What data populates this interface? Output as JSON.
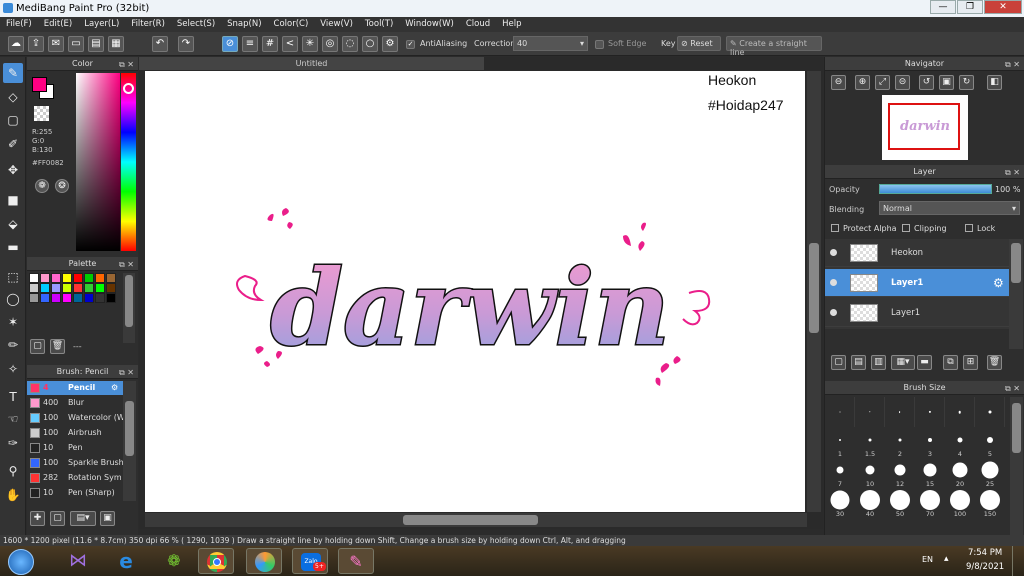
{
  "window": {
    "title": "MediBang Paint Pro (32bit)",
    "min": "—",
    "max": "❐",
    "close": "✕"
  },
  "menu": [
    "File(F)",
    "Edit(E)",
    "Layer(L)",
    "Filter(R)",
    "Select(S)",
    "Snap(N)",
    "Color(C)",
    "View(V)",
    "Tool(T)",
    "Window(W)",
    "Cloud",
    "Help"
  ],
  "toolbar": {
    "antialiasing_label": "AntiAliasing",
    "correction_label": "Correction",
    "correction_value": "40",
    "soft_edge_label": "Soft Edge",
    "key_label": "Key",
    "reset_label": "Reset",
    "straight_line_label": "Create a straight line"
  },
  "color_panel": {
    "title": "Color",
    "r": "R:255",
    "g": "G:0",
    "b": "B:130",
    "hex": "#FF0082",
    "primary_color": "#FF0082"
  },
  "palette_panel": {
    "title": "Palette",
    "swatches": [
      "#ffffff",
      "#ff99cc",
      "#ff66cc",
      "#ffff00",
      "#ff0000",
      "#00cc00",
      "#ff6600",
      "#996633",
      "#cccccc",
      "#00ccff",
      "#9999ff",
      "#ccff00",
      "#ff3333",
      "#33cc33",
      "#00ff00",
      "#663300",
      "#999999",
      "#3366ff",
      "#cc00ff",
      "#ff00ff",
      "#006699",
      "#0000cc",
      "#333333",
      "#000000"
    ],
    "footer": "---"
  },
  "brush_panel": {
    "title": "Brush: Pencil",
    "items": [
      {
        "size": "4",
        "name": "Pencil",
        "color": "#ff3366",
        "selected": true
      },
      {
        "size": "400",
        "name": "Blur",
        "color": "#ff99cc",
        "selected": false
      },
      {
        "size": "100",
        "name": "Watercolor (W",
        "color": "#66ccff",
        "selected": false
      },
      {
        "size": "100",
        "name": "Airbrush",
        "color": "#cccccc",
        "selected": false
      },
      {
        "size": "10",
        "name": "Pen",
        "color": "#222222",
        "selected": false
      },
      {
        "size": "100",
        "name": "Sparkle Brush",
        "color": "#3366ff",
        "selected": false
      },
      {
        "size": "282",
        "name": "Rotation Sym",
        "color": "#ff3333",
        "selected": false
      },
      {
        "size": "10",
        "name": "Pen (Sharp)",
        "color": "#222222",
        "selected": false
      }
    ]
  },
  "canvas": {
    "tab_title": "Untitled",
    "watermark_line1": "Heokon",
    "watermark_line2": "#Hoidap247",
    "artwork_text": "darwin"
  },
  "navigator": {
    "title": "Navigator",
    "thumb_text": "darwin"
  },
  "layer_panel": {
    "title": "Layer",
    "opacity_label": "Opacity",
    "opacity_value": "100 %",
    "blending_label": "Blending",
    "blending_value": "Normal",
    "protect_alpha": "Protect Alpha",
    "clipping": "Clipping",
    "lock": "Lock",
    "layers": [
      {
        "name": "Heokon",
        "selected": false
      },
      {
        "name": "Layer1",
        "selected": true
      },
      {
        "name": "Layer1",
        "selected": false
      }
    ]
  },
  "brush_size_panel": {
    "title": "Brush Size",
    "sizes": [
      "1",
      "1.5",
      "2",
      "3",
      "4",
      "5",
      "7",
      "10",
      "12",
      "15",
      "20",
      "25",
      "30",
      "40",
      "50",
      "70",
      "100",
      "150"
    ]
  },
  "status": {
    "text": "1600 * 1200 pixel   (11.6 * 8.7cm)   350 dpi   66 %   ( 1290, 1039 )   Draw a straight line by holding down Shift, Change a brush size by holding down Ctrl, Alt, and dragging"
  },
  "taskbar": {
    "language": "EN",
    "time": "7:54 PM",
    "date": "9/8/2021",
    "zalo_badge": "5+"
  }
}
